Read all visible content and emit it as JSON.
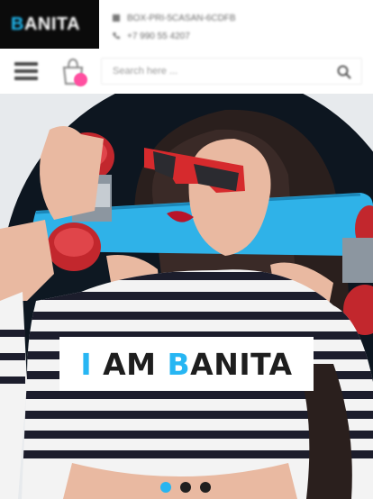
{
  "header": {
    "logo": {
      "first_letter": "B",
      "rest": "ANITA"
    },
    "contact": {
      "address": "BOX-PRI-5CASAN-6CDFB",
      "phone": "+7 990 55 4207"
    },
    "search": {
      "placeholder": "Search here ..."
    },
    "menu_icon": "hamburger-icon",
    "cart_icon": "shopping-bag-icon",
    "search_icon": "magnifier-icon"
  },
  "hero": {
    "caption_first": "I",
    "caption_mid": " AM ",
    "caption_accent": "B",
    "caption_rest": "ANITA"
  },
  "slider": {
    "slide_count": 3,
    "active_index": 0
  },
  "colors": {
    "accent": "#1fb8f0",
    "badge": "#ff4fa0",
    "logo_bg": "#0b0b0b"
  }
}
